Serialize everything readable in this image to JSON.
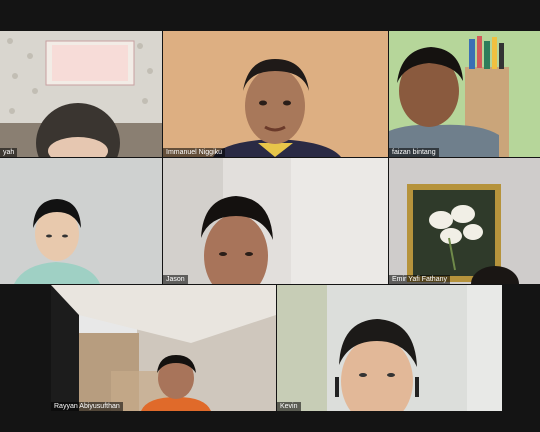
{
  "participants": [
    {
      "name": "yah"
    },
    {
      "name": "Immanuel Niggiku"
    },
    {
      "name": "faizan bintang"
    },
    {
      "name": ""
    },
    {
      "name": "Jason"
    },
    {
      "name": "Emir Yafi Fathany"
    },
    {
      "name": "Rayyan Abiyusufthan"
    },
    {
      "name": "Kevin"
    }
  ],
  "colors": {
    "background": "#141414",
    "name_tag_bg": "#000000",
    "name_tag_text": "#ffffff"
  }
}
